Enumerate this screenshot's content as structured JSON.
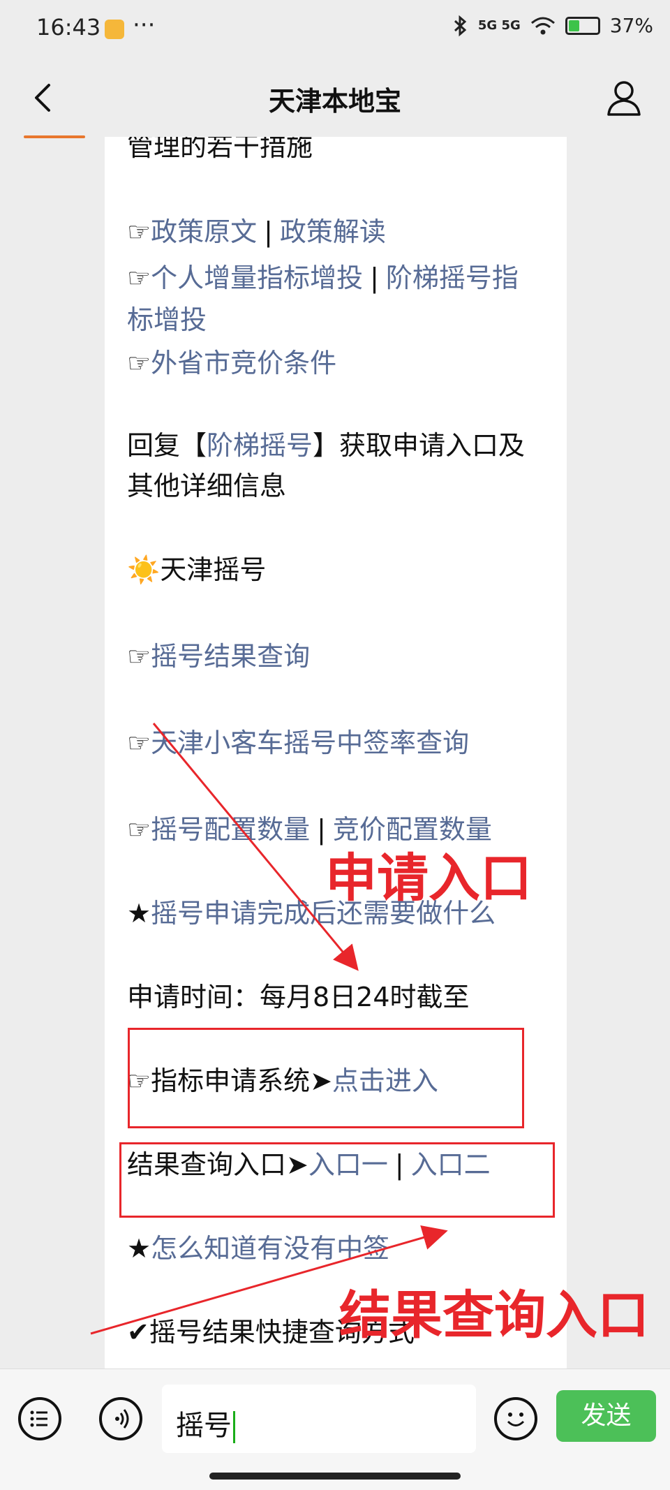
{
  "status_bar": {
    "time": "16:43",
    "dots": "···",
    "network": "5G 5G",
    "battery": "37%",
    "battery_level": 0.37
  },
  "nav": {
    "title": "天津本地宝",
    "back_icon": "chevron-left-icon",
    "profile_icon": "person-icon"
  },
  "article": {
    "line1": "管理的若干措施",
    "policy": {
      "prefix": "☞",
      "link1": "政策原文",
      "sep": "|",
      "link2": "政策解读"
    },
    "increase": {
      "prefix": "☞",
      "link1": "个人增量指标增投",
      "sep": "|",
      "link2_a": "阶梯摇号指",
      "link2_b": "标增投"
    },
    "outprov": {
      "prefix": "☞",
      "link": "外省市竞价条件"
    },
    "reply": {
      "a": "回复【",
      "link": "阶梯摇号",
      "b": "】获取申请入口及",
      "c": "其他详细信息"
    },
    "section": {
      "emoji": "☀️",
      "text": "天津摇号"
    },
    "result_query": {
      "prefix": "☞",
      "link": "摇号结果查询"
    },
    "rate_query": {
      "prefix": "☞",
      "link": "天津小客车摇号中签率查询"
    },
    "quota": {
      "prefix": "☞",
      "link1": "摇号配置数量",
      "sep": "|",
      "link2": "竞价配置数量"
    },
    "after_apply": {
      "prefix": "★",
      "link": "摇号申请完成后还需要做什么"
    },
    "apply_time": "申请时间：每月8日24时截至",
    "apply_system": {
      "prefix": "☞",
      "text": "指标申请系统➤",
      "link": "点击进入"
    },
    "result_entry": {
      "text": "结果查询入口➤",
      "link1": "入口一",
      "sep": "|",
      "link2": "入口二"
    },
    "how_know": {
      "prefix": "★",
      "link": "怎么知道有没有中签"
    },
    "quick": {
      "check": "✔",
      "text": "摇号结果快捷查询方式"
    }
  },
  "annotations": {
    "apply_label": "申请入口",
    "result_label": "结果查询入口",
    "color": "#e8262b"
  },
  "bottom_bar": {
    "menu_icon": "list-menu-icon",
    "voice_icon": "voice-icon",
    "input_value": "摇号",
    "emoji_icon": "smile-icon",
    "send_label": "发送"
  }
}
